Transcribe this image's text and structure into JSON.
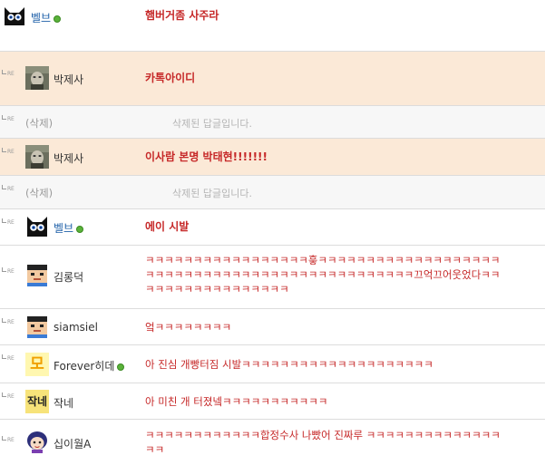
{
  "comments": [
    {
      "reply": false,
      "nick": "벨브",
      "online": true,
      "avatar_icon": "black-cat-icon",
      "text": "햄버거좀 사주라"
    },
    {
      "reply": true,
      "reply_label": "RE",
      "nick": "박제사",
      "online": false,
      "avatar_icon": "photo-avatar-icon",
      "text": "카톡아이디"
    },
    {
      "reply": true,
      "reply_label": "RE",
      "nick": "(삭제)",
      "deleted": true,
      "text": "삭제된 답글입니다."
    },
    {
      "reply": true,
      "reply_label": "RE",
      "nick": "박제사",
      "online": false,
      "avatar_icon": "photo-avatar-icon",
      "text": "이사람 본명 박태현!!!!!!!"
    },
    {
      "reply": true,
      "reply_label": "RE",
      "nick": "(삭제)",
      "deleted": true,
      "text": "삭제된 답글입니다."
    },
    {
      "reply": true,
      "reply_label": "RE",
      "nick": "벨브",
      "online": true,
      "avatar_icon": "black-cat-icon",
      "text": "에이 시발"
    },
    {
      "reply": true,
      "reply_label": "RE",
      "nick": "김롱덕",
      "online": false,
      "avatar_icon": "pixel-face-icon",
      "text": "ㅋㅋㅋㅋㅋㅋㅋㅋㅋㅋㅋㅋㅋㅋㅋㅋㅋ흫ㅋㅋㅋㅋㅋㅋㅋㅋㅋㅋㅋㅋㅋㅋㅋㅋㅋㅋㅋㅋㅋㅋㅋㅋㅋㅋㅋㅋㅋㅋㅋㅋㅋㅋㅋㅋㅋㅋㅋㅋㅋㅋㅋㅋㅋㅋㅋ끄억끄어웃었다ㅋㅋㅋㅋㅋㅋㅋㅋㅋㅋㅋㅋㅋㅋㅋㅋㅋ"
    },
    {
      "reply": true,
      "reply_label": "RE",
      "nick": "siamsiel",
      "online": false,
      "avatar_icon": "pixel-face-icon",
      "text": "엌ㅋㅋㅋㅋㅋㅋㅋㅋ"
    },
    {
      "reply": true,
      "reply_label": "RE",
      "nick": "Forever히데",
      "online": true,
      "avatar_icon": "letter-mo-icon",
      "avatar_char": "모",
      "text": "아 진심 개빵터짐 시발ㅋㅋㅋㅋㅋㅋㅋㅋㅋㅋㅋㅋㅋㅋㅋㅋㅋㅋㅋㅋ"
    },
    {
      "reply": true,
      "reply_label": "RE",
      "nick": "작네",
      "online": false,
      "avatar_icon": "letter-jakne-icon",
      "avatar_char": "작네",
      "text": "아 미친 개 터졌넼ㅋㅋㅋㅋㅋㅋㅋㅋㅋㅋㅋ"
    },
    {
      "reply": true,
      "reply_label": "RE",
      "nick": "십이월A",
      "online": false,
      "avatar_icon": "cartoon-girl-icon",
      "text": "ㅋㅋㅋㅋㅋㅋㅋㅋㅋㅋㅋㅋ합정수사 나빴어 진짜루 ㅋㅋㅋㅋㅋㅋㅋㅋㅋㅋㅋㅋㅋㅋㅋㅋ"
    }
  ]
}
